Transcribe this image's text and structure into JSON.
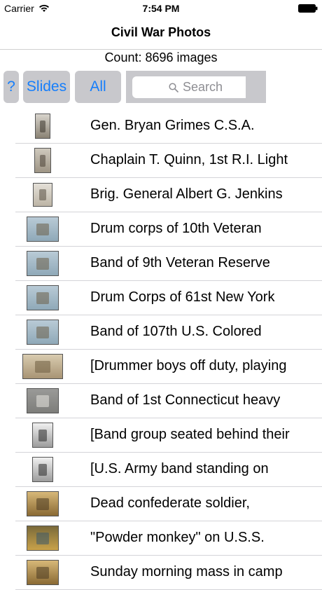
{
  "status": {
    "carrier": "Carrier",
    "time": "7:54 PM"
  },
  "nav": {
    "title": "Civil War Photos"
  },
  "count_label": "Count: 8696 images",
  "toolbar": {
    "help_label": "?",
    "slides_label": "Slides",
    "all_label": "All",
    "search_placeholder": "Search"
  },
  "colors": {
    "accent": "#157efb",
    "toolbar_bg": "#c8c8cc",
    "separator": "#d4d4d8",
    "placeholder": "#8e8e93"
  },
  "icons": [
    "wifi-icon",
    "battery-icon",
    "search-icon"
  ],
  "rows": [
    {
      "label": "Gen. Bryan Grimes C.S.A.",
      "thumb": "portrait-sepia"
    },
    {
      "label": "Chaplain T. Quinn, 1st R.I. Light",
      "thumb": "portrait-standing"
    },
    {
      "label": "Brig. General Albert G. Jenkins",
      "thumb": "portrait-light"
    },
    {
      "label": "Drum corps of 10th Veteran",
      "thumb": "group-blue"
    },
    {
      "label": "Band of 9th Veteran Reserve",
      "thumb": "group-blue"
    },
    {
      "label": "Drum Corps of 61st New York",
      "thumb": "group-blue"
    },
    {
      "label": "Band of 107th U.S. Colored",
      "thumb": "group-blue"
    },
    {
      "label": "[Drummer boys off duty, playing",
      "thumb": "sepia-wide"
    },
    {
      "label": "Band of 1st Connecticut heavy",
      "thumb": "gray-mount"
    },
    {
      "label": "[Band group seated behind their",
      "thumb": "bw-framed"
    },
    {
      "label": "[U.S. Army band standing on",
      "thumb": "bw-framed"
    },
    {
      "label": "Dead confederate soldier,",
      "thumb": "sepia-framed"
    },
    {
      "label": "\"Powder monkey\" on U.S.S.",
      "thumb": "color-framed"
    },
    {
      "label": "Sunday morning mass in camp",
      "thumb": "sepia-framed"
    }
  ]
}
